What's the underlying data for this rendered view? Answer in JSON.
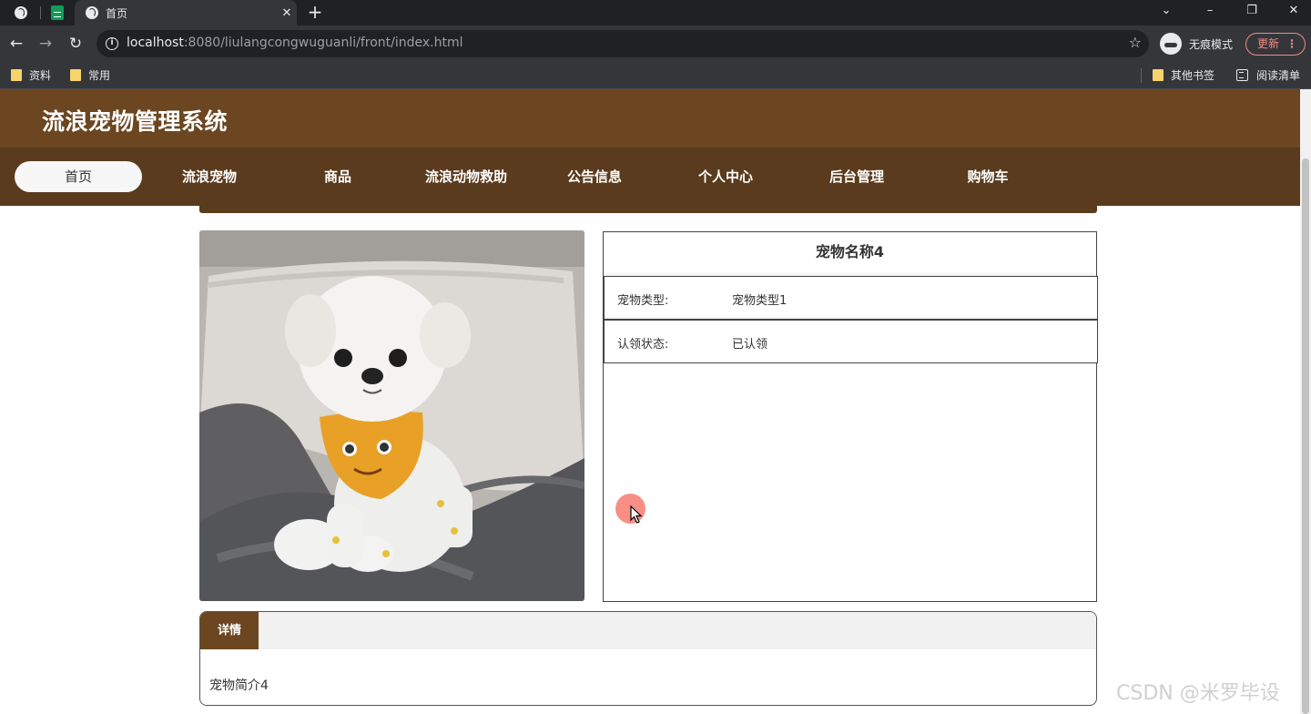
{
  "browser": {
    "tab_title": "首页",
    "url_host": "localhost",
    "url_rest": ":8080/liulangcongwuguanli/front/index.html",
    "incognito_label": "无痕模式",
    "update_label": "更新",
    "bookmarks": [
      "资料",
      "常用"
    ],
    "bookmarks_right": [
      "其他书签",
      "阅读清单"
    ]
  },
  "site": {
    "title": "流浪宠物管理系统",
    "nav": [
      "首页",
      "流浪宠物",
      "商品",
      "流浪动物救助",
      "公告信息",
      "个人中心",
      "后台管理",
      "购物车"
    ],
    "active_nav": "首页"
  },
  "pet": {
    "name": "宠物名称4",
    "fields": [
      {
        "label": "宠物类型:",
        "value": "宠物类型1"
      },
      {
        "label": "认领状态:",
        "value": "已认领"
      }
    ],
    "detail_tab": "详情",
    "intro": "宠物简介4"
  },
  "colors": {
    "header_brown": "#6b4620",
    "nav_brown": "#5a3b1d",
    "accent_red": "#f28b82"
  },
  "watermark": "CSDN @米罗毕设"
}
